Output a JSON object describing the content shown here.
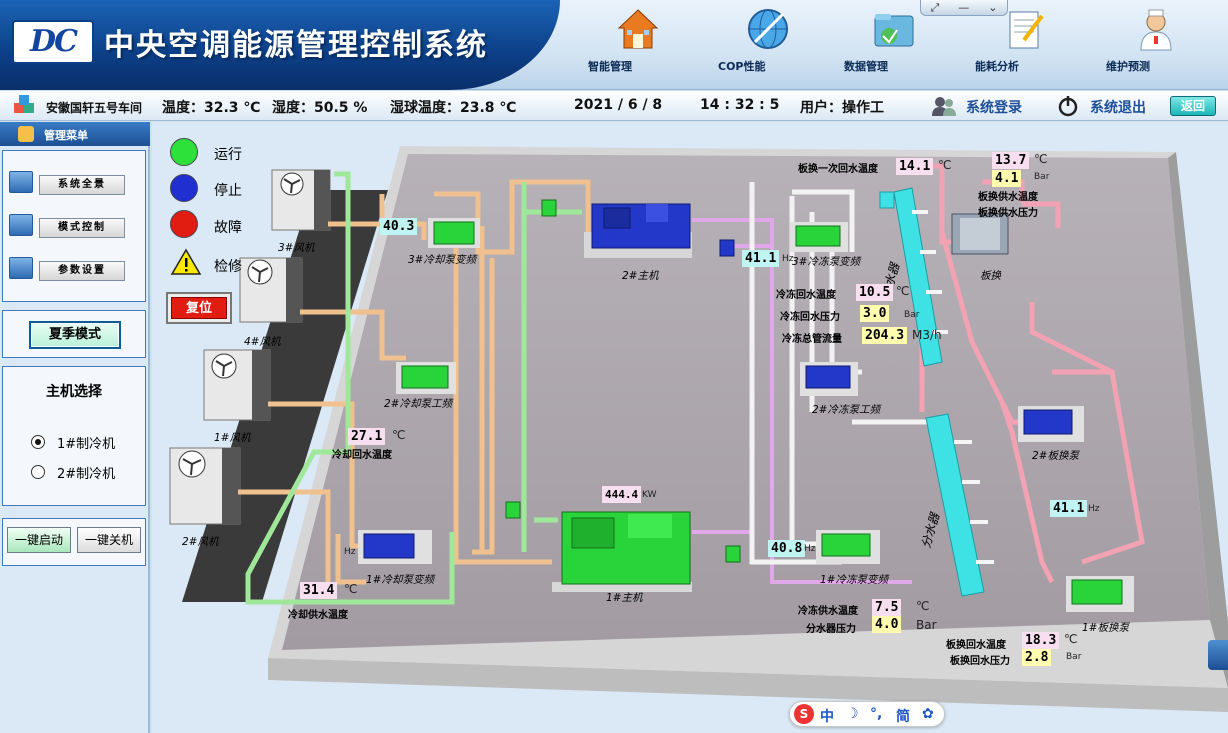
{
  "app": {
    "logo": "DC",
    "title": "中央空调能源管理控制系统"
  },
  "nav": [
    {
      "label": "智能管理",
      "icon": "house-icon"
    },
    {
      "label": "COP性能",
      "icon": "globe-icon"
    },
    {
      "label": "数据管理",
      "icon": "folder-icon"
    },
    {
      "label": "能耗分析",
      "icon": "notepad-icon"
    },
    {
      "label": "维护预测",
      "icon": "doctor-icon"
    }
  ],
  "status": {
    "location": "安徽国轩五号车间",
    "temperature": "温度：32.3 ℃",
    "humidity": "湿度：50.5 %",
    "wetbulb": "湿球温度：23.8 ℃",
    "date": "2021 / 6  / 8",
    "time": "14 : 32 : 5",
    "user": "用户：操作工",
    "login": "系统登录",
    "logout": "系统退出",
    "back": "返回"
  },
  "sidebar": {
    "menu_title": "管理菜单",
    "menu_items": [
      "系统全景",
      "模式控制",
      "参数设置"
    ],
    "mode": "夏季模式",
    "host_select_title": "主机选择",
    "hosts": [
      {
        "label": "1#制冷机",
        "selected": true
      },
      {
        "label": "2#制冷机",
        "selected": false
      }
    ],
    "start_all": "一键启动",
    "stop_all": "一键关机"
  },
  "legend": {
    "running": "运行",
    "stopped": "停止",
    "fault": "故障",
    "maintenance": "检修",
    "reset": "复位"
  },
  "colors": {
    "running": "#2ee03a",
    "stopped": "#1f2fd0",
    "fault": "#e11d12",
    "maintenance": "#ffe800"
  },
  "equipment": {
    "fan3": "3#风机",
    "fan4": "4#风机",
    "fan1": "1#风机",
    "fan2": "2#风机",
    "cool_pump3": "3#冷却泵变频",
    "cool_pump2": "2#冷却泵工频",
    "cool_pump1": "1#冷却泵变频",
    "chiller2": "2#主机",
    "chiller1": "1#主机",
    "chill_pump3": "3#冷冻泵变频",
    "chill_pump2": "2#冷冻泵工频",
    "chill_pump1": "1#冷冻泵变频",
    "plate": "板换",
    "plate_pump2": "2#板换泵",
    "plate_pump1": "1#板换泵",
    "distributor": "分水器",
    "collector": "集水器"
  },
  "readings": {
    "cool_pump3_hz": "40.3",
    "chill_pump3_hz": "41.1",
    "chill_pump1_hz": "40.8",
    "plate_pump_hz": "41.1",
    "hz_unit": "Hz",
    "cool_return_label": "冷却回水温度",
    "cool_return_temp": "27.1",
    "cool_supply_label": "冷却供水温度",
    "cool_supply_temp": "31.4",
    "power": "444.4",
    "power_unit": "KW",
    "plate_primary_label": "板换一次回水温度",
    "plate_primary_temp": "14.1",
    "plate_supply_temp_label": "板换供水温度",
    "plate_supply_temp": "13.7",
    "plate_supply_press_label": "板换供水压力",
    "plate_supply_press": "4.1",
    "chill_return_label": "冷冻回水温度",
    "chill_return_temp": "10.5",
    "chill_return_press_label": "冷冻回水压力",
    "chill_return_press": "3.0",
    "chill_flow_label": "冷冻总管流量",
    "chill_flow": "204.3",
    "flow_unit": "M3/h",
    "chill_supply_label": "冷冻供水温度",
    "chill_supply_temp": "7.5",
    "dist_press_label": "分水器压力",
    "dist_press": "4.0",
    "plate_return_temp_label": "板换回水温度",
    "plate_return_temp": "18.3",
    "plate_return_press_label": "板换回水压力",
    "plate_return_press": "2.8",
    "temp_unit": "℃",
    "press_unit": "Bar"
  },
  "ime": {
    "logo": "S",
    "lang": "中",
    "moon": "☽",
    "punct": "°,",
    "script": "简",
    "settings": "✿"
  }
}
